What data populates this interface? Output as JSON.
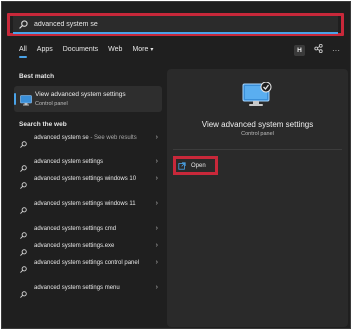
{
  "search": {
    "value": "advanced system se"
  },
  "tabs": [
    {
      "label": "All"
    },
    {
      "label": "Apps"
    },
    {
      "label": "Documents"
    },
    {
      "label": "Web"
    },
    {
      "label": "More"
    }
  ],
  "toolbar": {
    "profile_initial": "H"
  },
  "best_match": {
    "heading": "Best match",
    "title": "View advanced system settings",
    "subtitle": "Control panel"
  },
  "web": {
    "heading": "Search the web",
    "items": [
      {
        "text": "advanced system se",
        "suffix": " - See web results"
      },
      {
        "text": "advanced system settings"
      },
      {
        "text": "advanced system settings windows 10"
      },
      {
        "text": "advanced system settings windows 11"
      },
      {
        "text": "advanced system settings cmd"
      },
      {
        "text": "advanced system settings.exe"
      },
      {
        "text": "advanced system settings control panel"
      },
      {
        "text": "advanced system settings menu"
      }
    ]
  },
  "preview": {
    "title": "View advanced system settings",
    "subtitle": "Control panel",
    "open_label": "Open"
  },
  "colors": {
    "accent": "#4aa3e8",
    "highlight": "#c8283a",
    "panel": "#1f1f1f"
  }
}
